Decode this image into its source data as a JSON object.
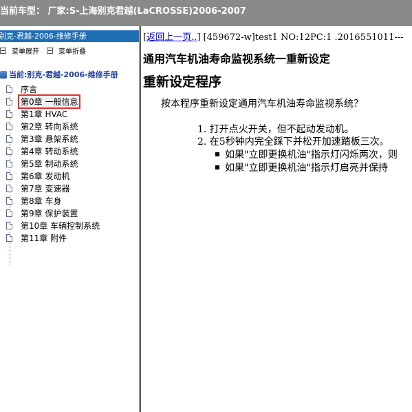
{
  "titlebar": {
    "text": "当前车型：  厂家:S-上海别克君越(LaCROSSE)2006-2007"
  },
  "left": {
    "header": "别克-君越-2006-维修手册",
    "toolbar": {
      "expand_label": "菜单展开",
      "collapse_label": "菜单折叠"
    },
    "root_label": "当前:别克-君越-2006-维修手册",
    "items": [
      {
        "label": "序言"
      },
      {
        "label": "第0章 一般信息",
        "selected": true
      },
      {
        "label": "第1章 HVAC"
      },
      {
        "label": "第2章 转向系统"
      },
      {
        "label": "第3章 悬架系统"
      },
      {
        "label": "第4章 转动系统"
      },
      {
        "label": "第5章 制动系统"
      },
      {
        "label": "第6章 发动机"
      },
      {
        "label": "第7章 变速器"
      },
      {
        "label": "第8章 车身"
      },
      {
        "label": "第9章 保护装置"
      },
      {
        "label": "第10章 车辆控制系统"
      },
      {
        "label": "第11章 附件"
      }
    ]
  },
  "content": {
    "back_link": "返回上一页..",
    "meta": " [459672-w]test1 NO:12PC:1 .2016551011---",
    "title": "通用汽车机油寿命监视系统一重新设定",
    "section": "重新设定程序",
    "intro": "按本程序重新设定通用汽车机油寿命监视系统？",
    "steps": [
      "1. 打开点火开关，但不起动发动机。",
      "2. 在5秒钟内完全踩下并松开加速踏板三次。"
    ],
    "bullets": [
      "如果\"立即更换机油\"指示灯闪烁两次，则",
      "如果\"立即更换机油\"指示灯启亮并保持"
    ]
  }
}
